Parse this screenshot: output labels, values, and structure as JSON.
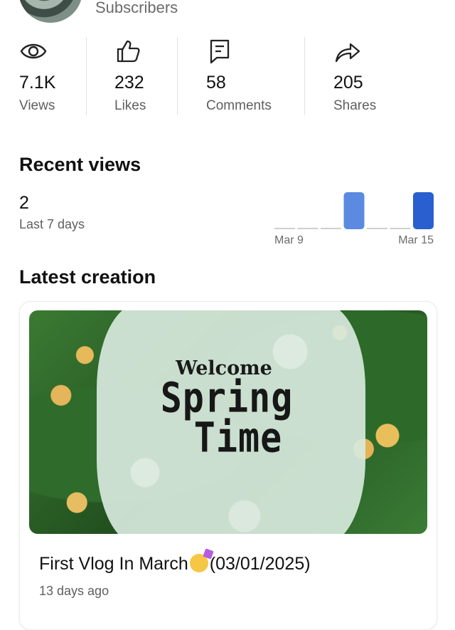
{
  "profile": {
    "subscribers_label": "Subscribers"
  },
  "stats": [
    {
      "icon": "eye-icon",
      "value": "7.1K",
      "label": "Views"
    },
    {
      "icon": "thumbs-up-icon",
      "value": "232",
      "label": "Likes"
    },
    {
      "icon": "comment-icon",
      "value": "58",
      "label": "Comments"
    },
    {
      "icon": "share-icon",
      "value": "205",
      "label": "Shares"
    }
  ],
  "recent_views": {
    "heading": "Recent views",
    "value": "2",
    "period": "Last 7 days"
  },
  "chart_data": {
    "type": "bar",
    "categories": [
      "Mar 9",
      "Mar 10",
      "Mar 11",
      "Mar 12",
      "Mar 13",
      "Mar 14",
      "Mar 15"
    ],
    "values": [
      0,
      0,
      0,
      1,
      0,
      0,
      1
    ],
    "tick_labels": [
      "Mar 9",
      "Mar 15"
    ],
    "colors": {
      "highlight": "#2a5fd0",
      "bar": "#5b8ae0",
      "zero": "#cfcfcf"
    },
    "title": "",
    "xlabel": "",
    "ylabel": ""
  },
  "latest": {
    "heading": "Latest creation",
    "thumb_line1": "Welcome",
    "thumb_line2": "Spring",
    "thumb_line3": "Time",
    "title_before": "First Vlog In March",
    "title_emoji": "partying-face-emoji",
    "title_after": "(03/01/2025)",
    "age": "13 days ago"
  },
  "colors": {
    "accent": "#2a5fd0",
    "muted": "#5f5f5f"
  }
}
